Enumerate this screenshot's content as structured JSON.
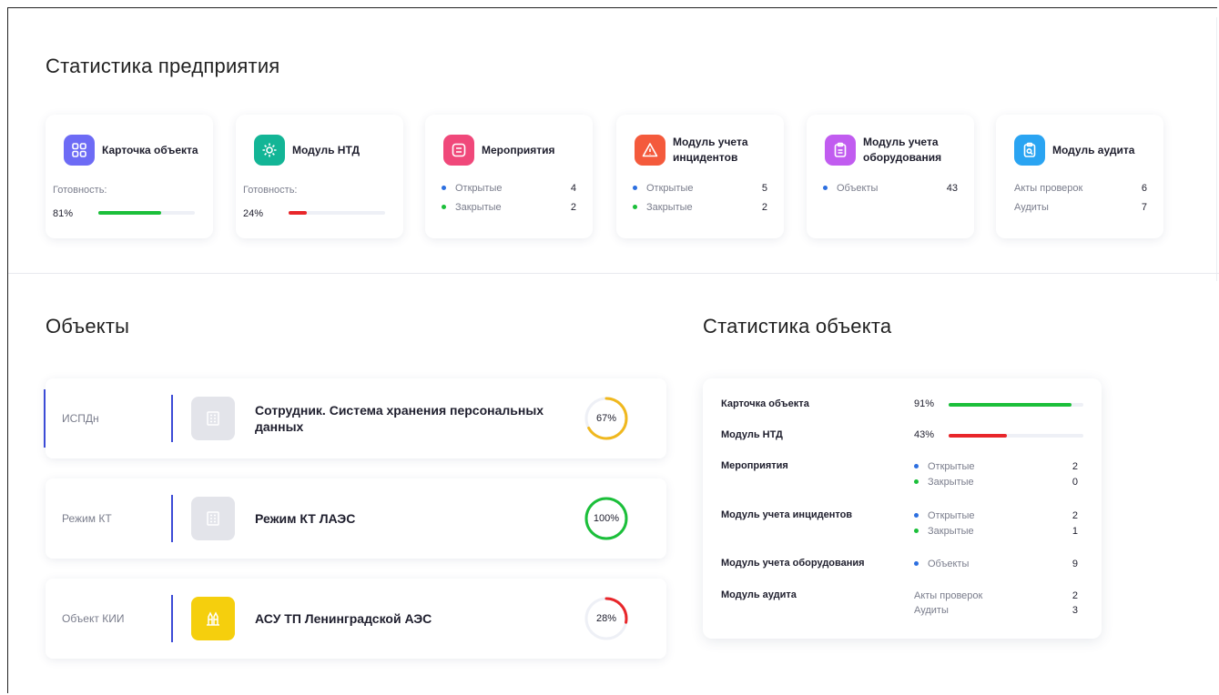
{
  "enterprise": {
    "title": "Статистика предприятия",
    "cards": [
      {
        "title": "Карточка объекта",
        "icon": "grid-icon",
        "color": "#6d6bf5",
        "readiness_label": "Готовность:",
        "percent": "81%",
        "progress": 0.81,
        "bar_color": "#1bbf3a"
      },
      {
        "title": "Модуль НТД",
        "icon": "gear-icon",
        "color": "#13b596",
        "readiness_label": "Готовность:",
        "percent": "24%",
        "progress": 0.24,
        "bar_color": "#e8262a"
      },
      {
        "title": "Мероприятия",
        "icon": "checklist-icon",
        "color": "#f0487a",
        "rows": [
          {
            "label": "Открытые",
            "value": "4"
          },
          {
            "label": "Закрытые",
            "value": "2"
          }
        ]
      },
      {
        "title": "Модуль учета инцидентов",
        "icon": "warning-icon",
        "color": "#f45a3c",
        "rows": [
          {
            "label": "Открытые",
            "value": "5"
          },
          {
            "label": "Закрытые",
            "value": "2"
          }
        ]
      },
      {
        "title": "Модуль учета оборудования",
        "icon": "clipboard-icon",
        "color": "#c15cf0",
        "rows": [
          {
            "label": "Объекты",
            "value": "43"
          }
        ]
      },
      {
        "title": "Модуль аудита",
        "icon": "audit-icon",
        "color": "#2aa4f2",
        "rows": [
          {
            "label": "Акты проверок",
            "value": "6"
          },
          {
            "label": "Аудиты",
            "value": "7"
          }
        ]
      }
    ]
  },
  "objects": {
    "title": "Объекты",
    "items": [
      {
        "category": "ИСПДн",
        "name": "Сотрудник. Система хранения персональных данных",
        "percent": "67%",
        "progress": 0.67,
        "ring_color": "#f0b81e",
        "icon_bg": "#e3e4ea",
        "icon": "building-icon"
      },
      {
        "category": "Режим КТ",
        "name": "Режим КТ ЛАЭС",
        "percent": "100%",
        "progress": 1.0,
        "ring_color": "#1bbf3a",
        "icon_bg": "#e3e4ea",
        "icon": "building-icon"
      },
      {
        "category": "Объект КИИ",
        "name": "АСУ ТП Ленинградской АЭС",
        "percent": "28%",
        "progress": 0.28,
        "ring_color": "#e8262a",
        "icon_bg": "#f5cf0d",
        "icon": "power-plant-icon"
      }
    ]
  },
  "object_stats": {
    "title": "Статистика объекта",
    "card_label": "Карточка объекта",
    "card_percent": "91%",
    "card_progress": 0.91,
    "ntd_label": "Модуль НТД",
    "ntd_percent": "43%",
    "ntd_progress": 0.43,
    "events_label": "Мероприятия",
    "events_open_label": "Открытые",
    "events_open": "2",
    "events_closed_label": "Закрытые",
    "events_closed": "0",
    "incidents_label": "Модуль учета инцидентов",
    "incidents_open_label": "Открытые",
    "incidents_open": "2",
    "incidents_closed_label": "Закрытые",
    "incidents_closed": "1",
    "equipment_label": "Модуль учета оборудования",
    "equipment_objects_label": "Объекты",
    "equipment_objects": "9",
    "audit_label": "Модуль аудита",
    "audit_acts_label": "Акты проверок",
    "audit_acts": "2",
    "audit_audits_label": "Аудиты",
    "audit_audits": "3"
  },
  "colors": {
    "open_dot": "#2d6fe0",
    "closed_dot": "#1bbf3a",
    "green": "#1bbf3a",
    "red": "#e8262a",
    "accent": "#3c4bd6"
  }
}
